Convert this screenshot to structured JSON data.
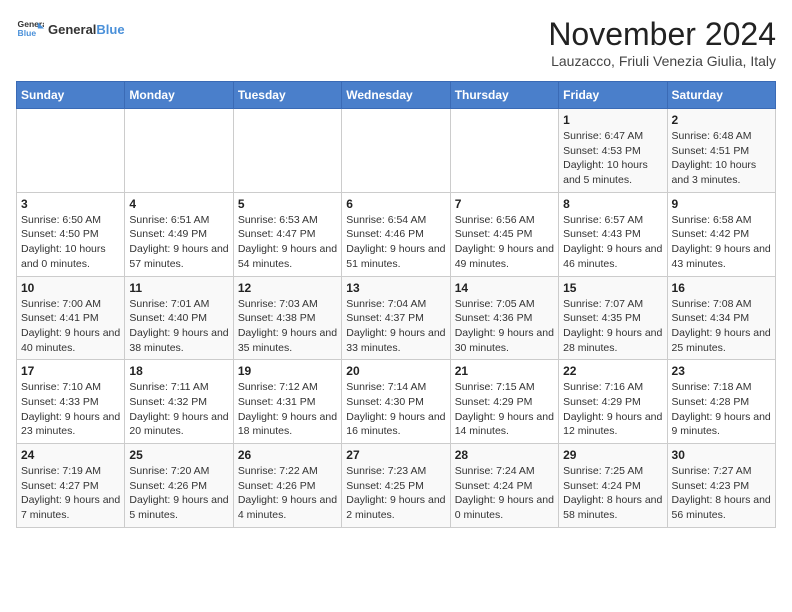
{
  "header": {
    "logo_line1": "General",
    "logo_line2": "Blue",
    "title": "November 2024",
    "subtitle": "Lauzacco, Friuli Venezia Giulia, Italy"
  },
  "columns": [
    "Sunday",
    "Monday",
    "Tuesday",
    "Wednesday",
    "Thursday",
    "Friday",
    "Saturday"
  ],
  "weeks": [
    {
      "days": [
        {
          "num": "",
          "info": ""
        },
        {
          "num": "",
          "info": ""
        },
        {
          "num": "",
          "info": ""
        },
        {
          "num": "",
          "info": ""
        },
        {
          "num": "",
          "info": ""
        },
        {
          "num": "1",
          "info": "Sunrise: 6:47 AM\nSunset: 4:53 PM\nDaylight: 10 hours and 5 minutes."
        },
        {
          "num": "2",
          "info": "Sunrise: 6:48 AM\nSunset: 4:51 PM\nDaylight: 10 hours and 3 minutes."
        }
      ]
    },
    {
      "days": [
        {
          "num": "3",
          "info": "Sunrise: 6:50 AM\nSunset: 4:50 PM\nDaylight: 10 hours and 0 minutes."
        },
        {
          "num": "4",
          "info": "Sunrise: 6:51 AM\nSunset: 4:49 PM\nDaylight: 9 hours and 57 minutes."
        },
        {
          "num": "5",
          "info": "Sunrise: 6:53 AM\nSunset: 4:47 PM\nDaylight: 9 hours and 54 minutes."
        },
        {
          "num": "6",
          "info": "Sunrise: 6:54 AM\nSunset: 4:46 PM\nDaylight: 9 hours and 51 minutes."
        },
        {
          "num": "7",
          "info": "Sunrise: 6:56 AM\nSunset: 4:45 PM\nDaylight: 9 hours and 49 minutes."
        },
        {
          "num": "8",
          "info": "Sunrise: 6:57 AM\nSunset: 4:43 PM\nDaylight: 9 hours and 46 minutes."
        },
        {
          "num": "9",
          "info": "Sunrise: 6:58 AM\nSunset: 4:42 PM\nDaylight: 9 hours and 43 minutes."
        }
      ]
    },
    {
      "days": [
        {
          "num": "10",
          "info": "Sunrise: 7:00 AM\nSunset: 4:41 PM\nDaylight: 9 hours and 40 minutes."
        },
        {
          "num": "11",
          "info": "Sunrise: 7:01 AM\nSunset: 4:40 PM\nDaylight: 9 hours and 38 minutes."
        },
        {
          "num": "12",
          "info": "Sunrise: 7:03 AM\nSunset: 4:38 PM\nDaylight: 9 hours and 35 minutes."
        },
        {
          "num": "13",
          "info": "Sunrise: 7:04 AM\nSunset: 4:37 PM\nDaylight: 9 hours and 33 minutes."
        },
        {
          "num": "14",
          "info": "Sunrise: 7:05 AM\nSunset: 4:36 PM\nDaylight: 9 hours and 30 minutes."
        },
        {
          "num": "15",
          "info": "Sunrise: 7:07 AM\nSunset: 4:35 PM\nDaylight: 9 hours and 28 minutes."
        },
        {
          "num": "16",
          "info": "Sunrise: 7:08 AM\nSunset: 4:34 PM\nDaylight: 9 hours and 25 minutes."
        }
      ]
    },
    {
      "days": [
        {
          "num": "17",
          "info": "Sunrise: 7:10 AM\nSunset: 4:33 PM\nDaylight: 9 hours and 23 minutes."
        },
        {
          "num": "18",
          "info": "Sunrise: 7:11 AM\nSunset: 4:32 PM\nDaylight: 9 hours and 20 minutes."
        },
        {
          "num": "19",
          "info": "Sunrise: 7:12 AM\nSunset: 4:31 PM\nDaylight: 9 hours and 18 minutes."
        },
        {
          "num": "20",
          "info": "Sunrise: 7:14 AM\nSunset: 4:30 PM\nDaylight: 9 hours and 16 minutes."
        },
        {
          "num": "21",
          "info": "Sunrise: 7:15 AM\nSunset: 4:29 PM\nDaylight: 9 hours and 14 minutes."
        },
        {
          "num": "22",
          "info": "Sunrise: 7:16 AM\nSunset: 4:29 PM\nDaylight: 9 hours and 12 minutes."
        },
        {
          "num": "23",
          "info": "Sunrise: 7:18 AM\nSunset: 4:28 PM\nDaylight: 9 hours and 9 minutes."
        }
      ]
    },
    {
      "days": [
        {
          "num": "24",
          "info": "Sunrise: 7:19 AM\nSunset: 4:27 PM\nDaylight: 9 hours and 7 minutes."
        },
        {
          "num": "25",
          "info": "Sunrise: 7:20 AM\nSunset: 4:26 PM\nDaylight: 9 hours and 5 minutes."
        },
        {
          "num": "26",
          "info": "Sunrise: 7:22 AM\nSunset: 4:26 PM\nDaylight: 9 hours and 4 minutes."
        },
        {
          "num": "27",
          "info": "Sunrise: 7:23 AM\nSunset: 4:25 PM\nDaylight: 9 hours and 2 minutes."
        },
        {
          "num": "28",
          "info": "Sunrise: 7:24 AM\nSunset: 4:24 PM\nDaylight: 9 hours and 0 minutes."
        },
        {
          "num": "29",
          "info": "Sunrise: 7:25 AM\nSunset: 4:24 PM\nDaylight: 8 hours and 58 minutes."
        },
        {
          "num": "30",
          "info": "Sunrise: 7:27 AM\nSunset: 4:23 PM\nDaylight: 8 hours and 56 minutes."
        }
      ]
    }
  ]
}
